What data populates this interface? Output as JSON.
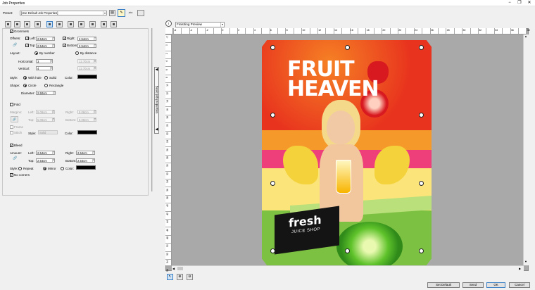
{
  "window": {
    "title": "Job Properties",
    "controls": [
      "−",
      "❐",
      "✕"
    ]
  },
  "preset": {
    "label": "Preset:",
    "value": "[Use Default Job Properties]"
  },
  "grommets": {
    "title": "Grommets",
    "offsets_label": "Offsets:",
    "left_label": "Left:",
    "left": "2.54cm",
    "right_label": "Right:",
    "right": "2.54cm",
    "top_label": "Top:",
    "top": "2.54cm",
    "bottom_label": "Bottom:",
    "bottom": "2.54cm",
    "layout_label": "Layout:",
    "by_number": "By number",
    "by_distance": "By distance",
    "horizontal_label": "Horizontal:",
    "horizontal": "3",
    "vertical_label": "Vertical:",
    "vertical": "4",
    "dist_h": "12.70cm",
    "dist_v": "12.70cm",
    "style_label": "Style:",
    "with_hole": "With hole",
    "solid": "Solid",
    "color_label": "Color:",
    "shape_label": "Shape:",
    "circle": "Circle",
    "rectangle": "Rectangle",
    "diameter_label": "Diameter:",
    "diameter": "2.50cm"
  },
  "fold": {
    "title": "Fold",
    "margins_label": "Margins:",
    "left_label": "Left:",
    "left": "5.08cm",
    "right_label": "Right:",
    "right": "5.08cm",
    "top_label": "Top:",
    "top": "5.08cm",
    "bottom_label": "Bottom:",
    "bottom": "5.08cm",
    "frame_label": "Frame",
    "stitch_label": "Stitch",
    "style_label": "Style:",
    "style_value": "Solid",
    "color_label": "Color:"
  },
  "bleed": {
    "title": "Bleed",
    "amount_label": "Amount:",
    "left_label": "Left:",
    "left": "2.54cm",
    "right_label": "Right:",
    "right": "2.54cm",
    "top_label": "Top:",
    "top": "2.54cm",
    "bottom_label": "Bottom:",
    "bottom": "2.54cm",
    "style_label": "Style:",
    "repeat": "Repeat",
    "mirror": "Mirror",
    "color": "Color:",
    "no_corners": "No corners"
  },
  "side_tab": {
    "label": "Basic job properties"
  },
  "preview": {
    "mode": "Finishing Preview",
    "ruler_h": [
      "-6",
      "-4",
      "-2",
      "0",
      "2",
      "4",
      "6",
      "8",
      "10",
      "12",
      "14",
      "16",
      "18",
      "20",
      "22",
      "24",
      "26",
      "28",
      "30",
      "32",
      "34",
      "36",
      "38",
      "40",
      "42"
    ],
    "ruler_v": [
      "-2",
      "0",
      "2",
      "4",
      "6",
      "8",
      "10",
      "12",
      "14",
      "16",
      "18",
      "20",
      "22",
      "24",
      "26",
      "28",
      "30",
      "32",
      "34",
      "36",
      "38",
      "40",
      "42",
      "44",
      "46",
      "48",
      "50",
      "52",
      "54",
      "56"
    ]
  },
  "artwork": {
    "headline1": "FRUIT",
    "headline2": "HEAVEN",
    "brand": "fresh",
    "brand_sub": "JUICE SHOP"
  },
  "buttons": {
    "set_default": "Set Default",
    "send": "Send",
    "ok": "OK",
    "cancel": "Cancel"
  },
  "colors": {
    "accent": "#3b7fc4",
    "art_red": "#e2261d",
    "art_orange": "#f5a12a",
    "art_green": "#7dc142"
  }
}
